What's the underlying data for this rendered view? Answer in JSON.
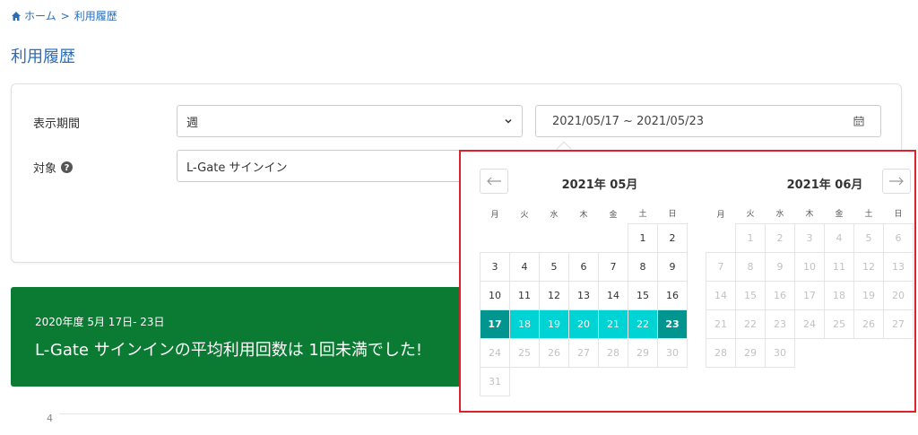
{
  "breadcrumb": {
    "home": "ホーム",
    "separator": ">",
    "current": "利用履歴"
  },
  "page_title": "利用履歴",
  "filters": {
    "period_label": "表示期間",
    "period_value": "週",
    "date_range": "2021/05/17 ~ 2021/05/23",
    "target_label": "対象",
    "target_value": "L-Gate サインイン"
  },
  "summary": {
    "period": "2020年度 5月 17日- 23日",
    "message": "L-Gate サインインの平均利用回数は 1回未満でした!"
  },
  "chart_axis": {
    "tick": "4"
  },
  "calendar": {
    "weekdays": [
      "月",
      "火",
      "水",
      "木",
      "金",
      "土",
      "日"
    ],
    "prev_icon": "arrow-left-icon",
    "next_icon": "arrow-right-icon",
    "colors": {
      "range": "#00d3d3",
      "range_edge": "#00968f",
      "highlight_border": "#e0202a"
    },
    "months": [
      {
        "title": "2021年 05月",
        "weeks": [
          [
            null,
            null,
            null,
            null,
            null,
            {
              "d": "1"
            },
            {
              "d": "2"
            }
          ],
          [
            {
              "d": "3"
            },
            {
              "d": "4"
            },
            {
              "d": "5"
            },
            {
              "d": "6"
            },
            {
              "d": "7"
            },
            {
              "d": "8"
            },
            {
              "d": "9"
            }
          ],
          [
            {
              "d": "10"
            },
            {
              "d": "11"
            },
            {
              "d": "12"
            },
            {
              "d": "13"
            },
            {
              "d": "14"
            },
            {
              "d": "15"
            },
            {
              "d": "16"
            }
          ],
          [
            {
              "d": "17",
              "s": "edge"
            },
            {
              "d": "18",
              "s": "range"
            },
            {
              "d": "19",
              "s": "range"
            },
            {
              "d": "20",
              "s": "range"
            },
            {
              "d": "21",
              "s": "range"
            },
            {
              "d": "22",
              "s": "range"
            },
            {
              "d": "23",
              "s": "edge"
            }
          ],
          [
            {
              "d": "24",
              "s": "disabled"
            },
            {
              "d": "25",
              "s": "disabled"
            },
            {
              "d": "26",
              "s": "disabled"
            },
            {
              "d": "27",
              "s": "disabled"
            },
            {
              "d": "28",
              "s": "disabled"
            },
            {
              "d": "29",
              "s": "disabled"
            },
            {
              "d": "30",
              "s": "disabled"
            }
          ],
          [
            {
              "d": "31",
              "s": "disabled"
            },
            null,
            null,
            null,
            null,
            null,
            null
          ]
        ]
      },
      {
        "title": "2021年 06月",
        "weeks": [
          [
            null,
            {
              "d": "1",
              "s": "disabled"
            },
            {
              "d": "2",
              "s": "disabled"
            },
            {
              "d": "3",
              "s": "disabled"
            },
            {
              "d": "4",
              "s": "disabled"
            },
            {
              "d": "5",
              "s": "disabled"
            },
            {
              "d": "6",
              "s": "disabled"
            }
          ],
          [
            {
              "d": "7",
              "s": "disabled"
            },
            {
              "d": "8",
              "s": "disabled"
            },
            {
              "d": "9",
              "s": "disabled"
            },
            {
              "d": "10",
              "s": "disabled"
            },
            {
              "d": "11",
              "s": "disabled"
            },
            {
              "d": "12",
              "s": "disabled"
            },
            {
              "d": "13",
              "s": "disabled"
            }
          ],
          [
            {
              "d": "14",
              "s": "disabled"
            },
            {
              "d": "15",
              "s": "disabled"
            },
            {
              "d": "16",
              "s": "disabled"
            },
            {
              "d": "17",
              "s": "disabled"
            },
            {
              "d": "18",
              "s": "disabled"
            },
            {
              "d": "19",
              "s": "disabled"
            },
            {
              "d": "20",
              "s": "disabled"
            }
          ],
          [
            {
              "d": "21",
              "s": "disabled"
            },
            {
              "d": "22",
              "s": "disabled"
            },
            {
              "d": "23",
              "s": "disabled"
            },
            {
              "d": "24",
              "s": "disabled"
            },
            {
              "d": "25",
              "s": "disabled"
            },
            {
              "d": "26",
              "s": "disabled"
            },
            {
              "d": "27",
              "s": "disabled"
            }
          ],
          [
            {
              "d": "28",
              "s": "disabled"
            },
            {
              "d": "29",
              "s": "disabled"
            },
            {
              "d": "30",
              "s": "disabled"
            },
            null,
            null,
            null,
            null
          ]
        ]
      }
    ]
  }
}
